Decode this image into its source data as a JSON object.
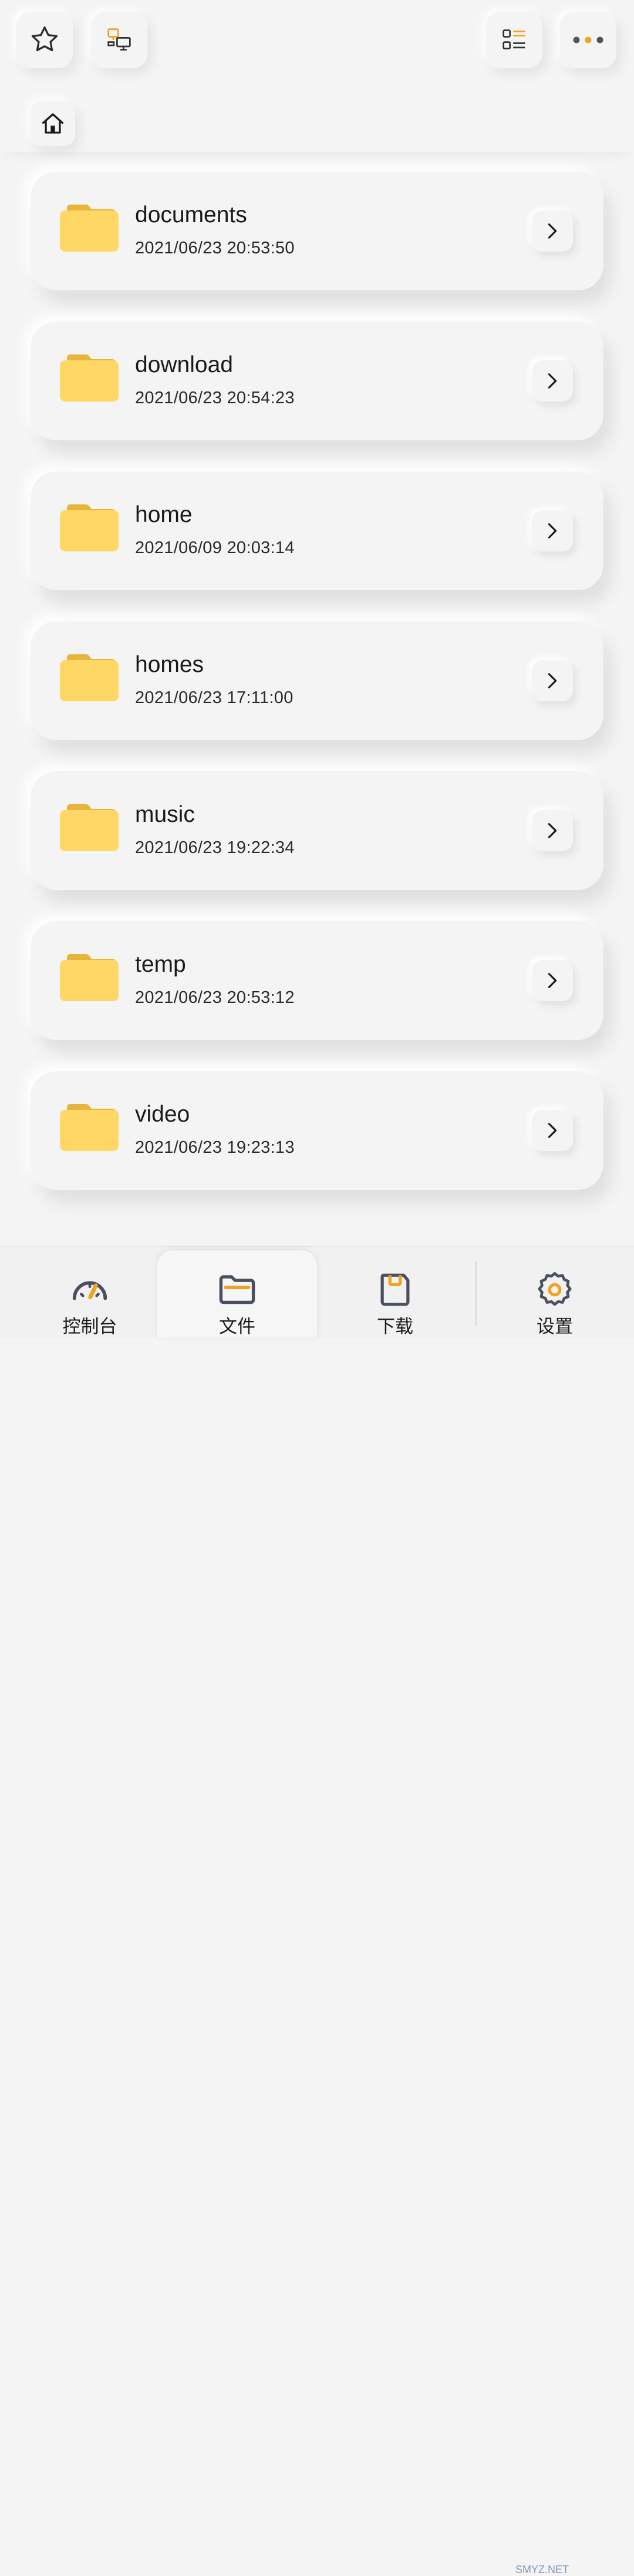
{
  "toolbar": {
    "favorites_icon": "star-icon",
    "remote_icon": "network-computer-icon",
    "view_icon": "list-view-icon",
    "more_icon": "more-dots-icon",
    "accent": "#f0a322"
  },
  "breadcrumb": {
    "home_icon": "home-icon"
  },
  "folders": [
    {
      "name": "documents",
      "date": "2021/06/23 20:53:50"
    },
    {
      "name": "download",
      "date": "2021/06/23 20:54:23"
    },
    {
      "name": "home",
      "date": "2021/06/09 20:03:14"
    },
    {
      "name": "homes",
      "date": "2021/06/23 17:11:00"
    },
    {
      "name": "music",
      "date": "2021/06/23 19:22:34"
    },
    {
      "name": "temp",
      "date": "2021/06/23 20:53:12"
    },
    {
      "name": "video",
      "date": "2021/06/23 19:23:13"
    }
  ],
  "folder_color": "#ffd764",
  "nav": {
    "dashboard": {
      "label": "控制台",
      "icon": "gauge-icon"
    },
    "files": {
      "label": "文件",
      "icon": "folder-icon"
    },
    "download": {
      "label": "下载",
      "icon": "download-icon"
    },
    "settings": {
      "label": "设置",
      "icon": "gear-icon"
    },
    "active": "files"
  },
  "watermark": "SMYZ.NET"
}
